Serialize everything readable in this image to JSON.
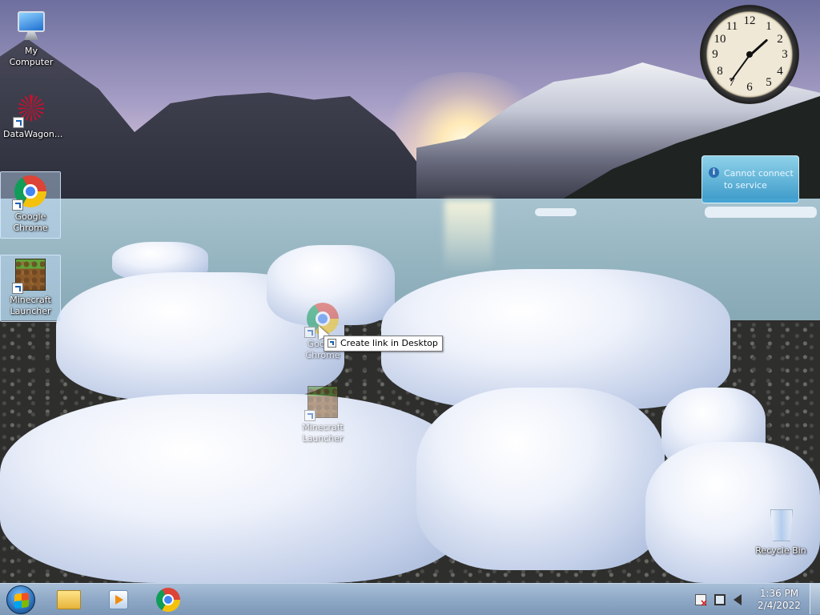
{
  "desktop": {
    "icons": [
      {
        "label": "My Computer",
        "icon": "computer-icon"
      },
      {
        "label": "DataWagon...",
        "icon": "snowflake-icon"
      },
      {
        "label": "Google Chrome",
        "icon": "chrome-icon"
      },
      {
        "label": "Minecraft Launcher",
        "icon": "minecraft-icon"
      },
      {
        "label": "Recycle Bin",
        "icon": "recycle-bin-icon"
      }
    ],
    "drag_ghosts": [
      {
        "label": "Google Chrome",
        "icon": "chrome-icon"
      },
      {
        "label": "Minecraft Launcher",
        "icon": "minecraft-icon"
      }
    ],
    "drag_tooltip": "Create link in Desktop"
  },
  "gadgets": {
    "clock": {
      "numbers": [
        "12",
        "1",
        "2",
        "3",
        "4",
        "5",
        "6",
        "7",
        "8",
        "9",
        "10",
        "11"
      ],
      "time": "1:36"
    },
    "notification": {
      "message": "Cannot connect to service",
      "icon": "info-icon"
    }
  },
  "taskbar": {
    "pinned": [
      {
        "icon": "windows-explorer-icon"
      },
      {
        "icon": "media-player-icon"
      },
      {
        "icon": "chrome-icon"
      }
    ],
    "tray": {
      "icons": [
        "action-center-alert-icon",
        "network-icon",
        "volume-icon"
      ],
      "time": "1:36 PM",
      "date": "2/4/2022"
    }
  }
}
